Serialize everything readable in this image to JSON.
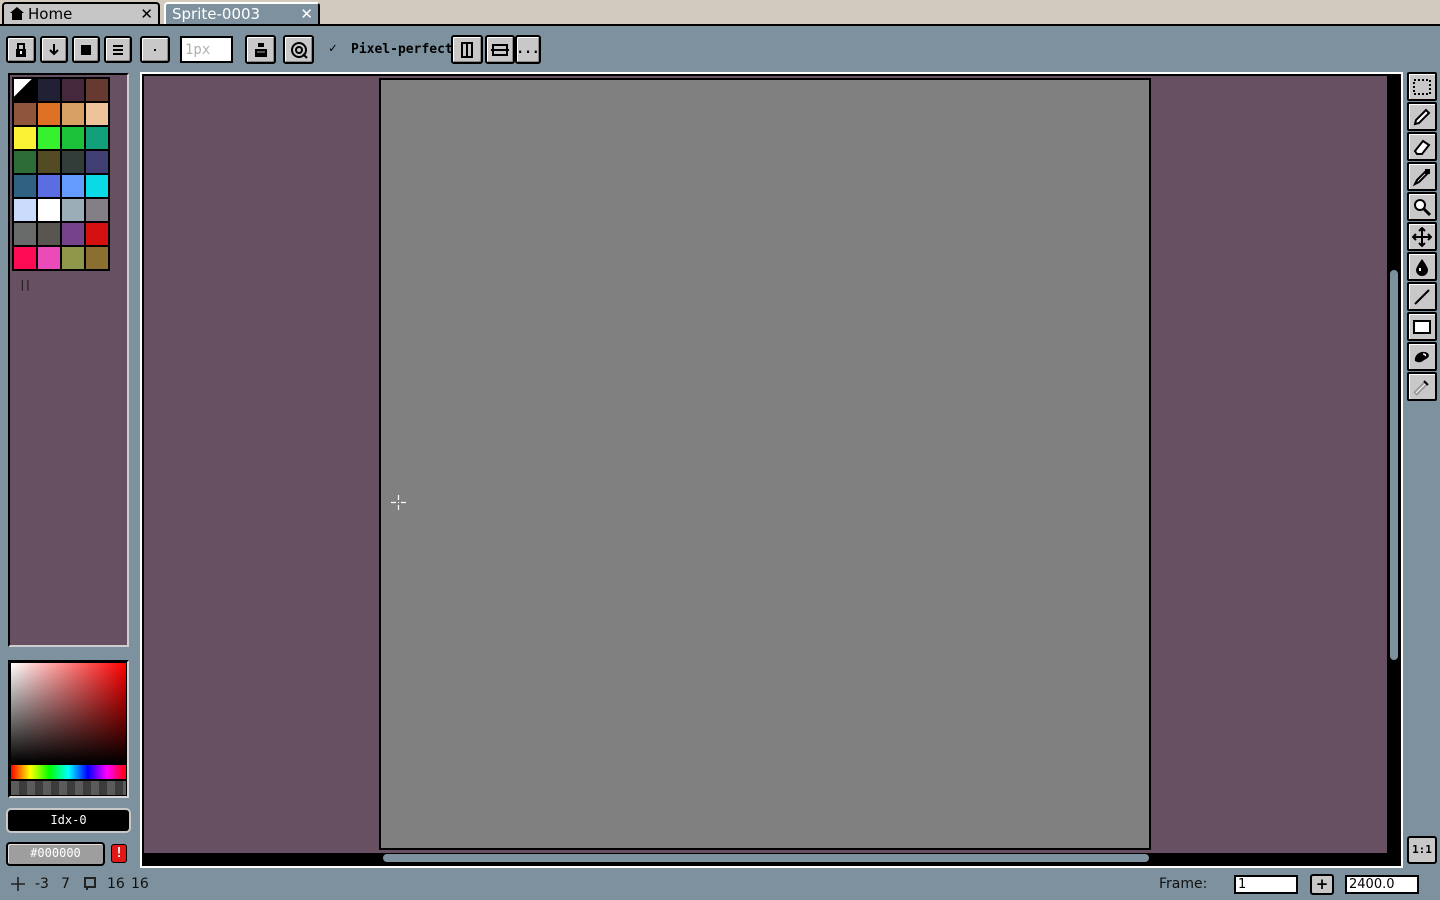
{
  "tabs": [
    {
      "label": "Home",
      "icon": "home-icon",
      "close": "✕"
    },
    {
      "label": "Sprite-0003",
      "close": "✕"
    }
  ],
  "toolbar": {
    "brush_size_placeholder": "1px",
    "pixel_perfect_check": "✓",
    "pixel_perfect_label": "Pixel-perfect",
    "more_label": "..."
  },
  "palette": {
    "colors": [
      "#000000",
      "#222034",
      "#45283c",
      "#663931",
      "#8f563b",
      "#df7126",
      "#d9a066",
      "#eec39a",
      "#fbf236",
      "#36f22e",
      "#1bc23a",
      "#11a079",
      "#2d6b37",
      "#524b24",
      "#323c39",
      "#3f3f74",
      "#306082",
      "#5b6ee1",
      "#639bff",
      "#0ad9e6",
      "#cbdbfc",
      "#ffffff",
      "#9badb7",
      "#847e87",
      "#696a6a",
      "#595652",
      "#76428a",
      "#d51010",
      "#ff0a54",
      "#ea4bb8",
      "#8f974a",
      "#8a6f30"
    ],
    "handle": "||"
  },
  "color_bar": {
    "index_label": "Idx-0",
    "hex_label": "#000000",
    "warning_label": "!"
  },
  "status": {
    "position_x": "-3",
    "position_y": "7",
    "size_w": "16",
    "size_h": "16",
    "frame_label": "Frame:",
    "frame_value": "1",
    "frame_add": "+",
    "zoom_value": "2400.0"
  },
  "zoom_reset_label": "1:1",
  "colors": {
    "chrome": "#7d929e",
    "editor_bg": "#665061",
    "sprite": "#808080",
    "tabbar": "#d2cbbd"
  }
}
